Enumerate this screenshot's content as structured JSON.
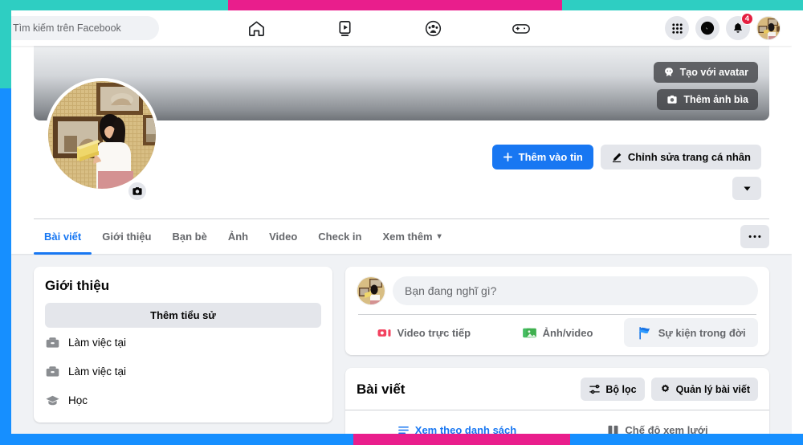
{
  "topbar": {
    "search": {
      "placeholder": "Tìm kiếm trên Facebook",
      "icon": "search-icon"
    },
    "nav_tabs": [
      {
        "name": "home-tab",
        "icon": "home-icon"
      },
      {
        "name": "watch-tab",
        "icon": "video-play-icon"
      },
      {
        "name": "groups-tab",
        "icon": "groups-icon"
      },
      {
        "name": "gaming-tab",
        "icon": "gamepad-icon"
      }
    ],
    "right": {
      "menu_icon": "grid-menu-icon",
      "messenger_icon": "messenger-icon",
      "notifications_icon": "bell-icon",
      "notification_count": "4",
      "avatar": "profile-avatar"
    }
  },
  "cover": {
    "create_avatar_label": "Tạo với avatar",
    "create_avatar_icon": "avatar-head-icon",
    "add_cover_label": "Thêm ảnh bìa",
    "add_cover_icon": "camera-icon"
  },
  "profile": {
    "avatar_camera_icon": "camera-icon",
    "add_story_label": "Thêm vào tin",
    "add_story_icon": "plus-icon",
    "edit_profile_label": "Chỉnh sửa trang cá nhân",
    "edit_profile_icon": "pencil-icon",
    "dropdown_icon": "chevron-down-icon",
    "more_icon": "ellipsis-icon"
  },
  "tabs": [
    {
      "label": "Bài viết",
      "active": true
    },
    {
      "label": "Giới thiệu",
      "active": false
    },
    {
      "label": "Bạn bè",
      "active": false
    },
    {
      "label": "Ảnh",
      "active": false
    },
    {
      "label": "Video",
      "active": false
    },
    {
      "label": "Check in",
      "active": false
    },
    {
      "label": "Xem thêm",
      "active": false,
      "caret": "▾"
    }
  ],
  "intro": {
    "title": "Giới thiệu",
    "add_bio_label": "Thêm tiểu sử",
    "items": [
      {
        "label": "Làm việc tại",
        "icon": "briefcase-icon"
      },
      {
        "label": "Làm việc tại",
        "icon": "briefcase-icon"
      },
      {
        "label": "Học",
        "icon": "graduation-cap-icon"
      }
    ]
  },
  "composer": {
    "placeholder": "Bạn đang nghĩ gì?",
    "actions": [
      {
        "label": "Video trực tiếp",
        "icon": "live-video-icon",
        "color": "#F3425F",
        "highlight": false
      },
      {
        "label": "Ảnh/video",
        "icon": "photo-icon",
        "color": "#45BD62",
        "highlight": false
      },
      {
        "label": "Sự kiện trong đời",
        "icon": "flag-icon",
        "color": "#1B74E4",
        "highlight": true
      }
    ]
  },
  "posts": {
    "title": "Bài viết",
    "filter_label": "Bộ lọc",
    "filter_icon": "sliders-icon",
    "manage_label": "Quản lý bài viết",
    "manage_icon": "gear-icon",
    "views": [
      {
        "label": "Xem theo danh sách",
        "icon": "list-icon",
        "active": true
      },
      {
        "label": "Chế độ xem lưới",
        "icon": "grid-icon",
        "active": false
      }
    ]
  },
  "colors": {
    "accent_blue": "#1877F2",
    "badge_red": "#E41E3F",
    "frame_teal": "#2ECEC2",
    "frame_pink": "#E91E8C",
    "frame_blue": "#168FFF",
    "page_bg": "#F0F2F5"
  }
}
